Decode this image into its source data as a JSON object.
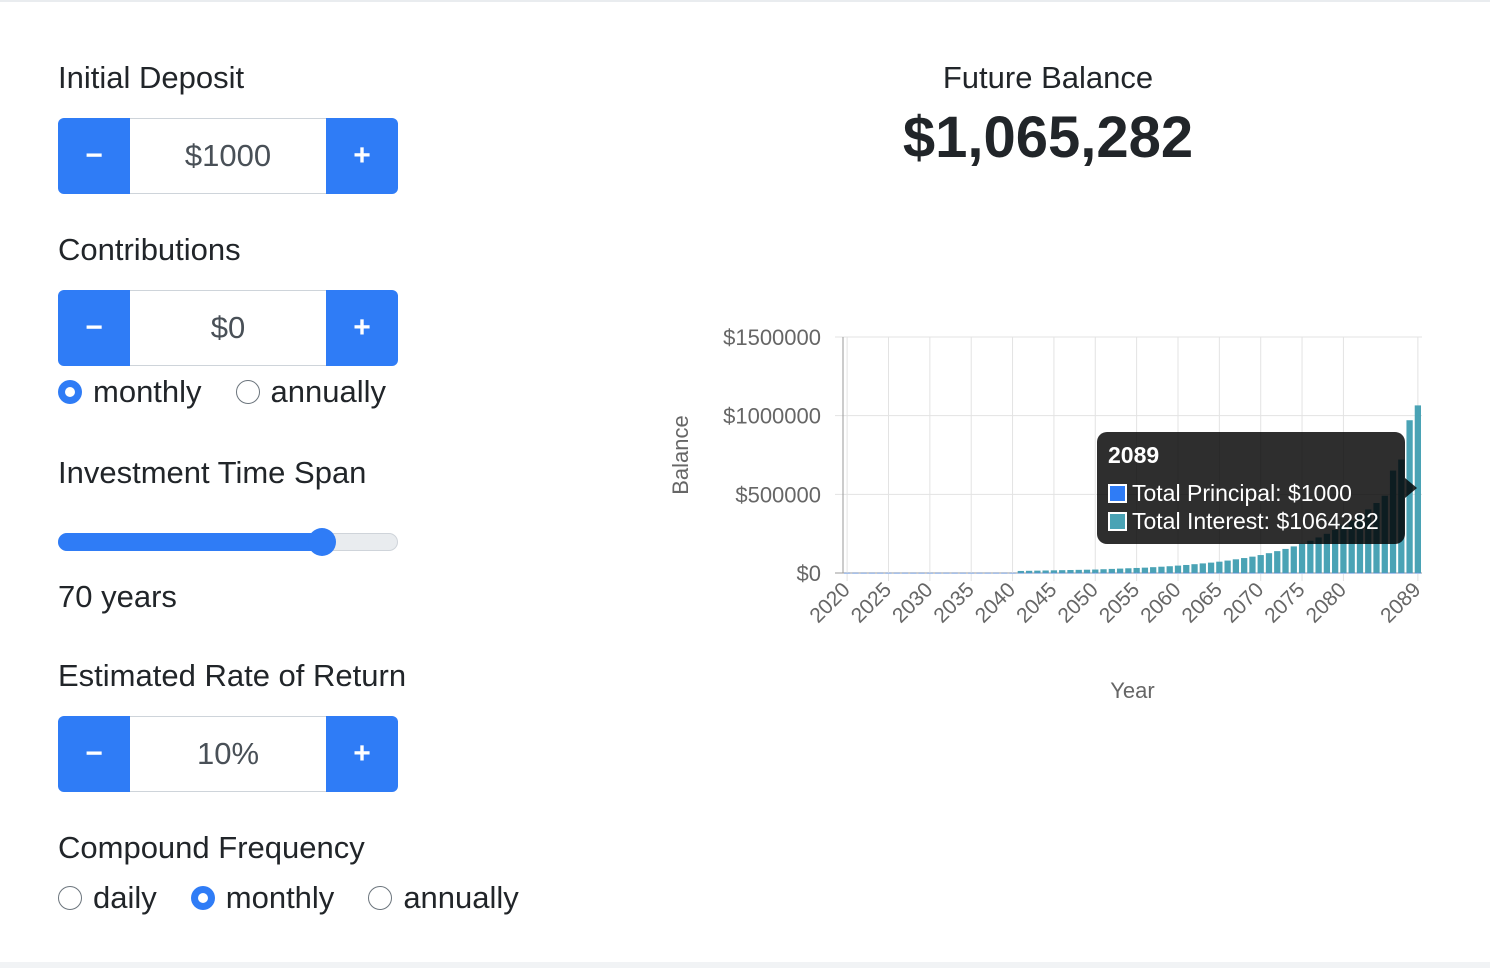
{
  "initial_deposit": {
    "label": "Initial Deposit",
    "minus": "−",
    "plus": "+",
    "value": "$1000"
  },
  "contributions": {
    "label": "Contributions",
    "minus": "−",
    "plus": "+",
    "value": "$0",
    "frequency_options": [
      {
        "label": "monthly",
        "selected": true
      },
      {
        "label": "annually",
        "selected": false
      }
    ]
  },
  "time_span": {
    "label": "Investment Time Span",
    "value_text": "70 years",
    "slider_fraction": 0.78
  },
  "rate_of_return": {
    "label": "Estimated Rate of Return",
    "minus": "−",
    "plus": "+",
    "value": "10%"
  },
  "compound_frequency": {
    "label": "Compound Frequency",
    "options": [
      {
        "label": "daily",
        "selected": false
      },
      {
        "label": "monthly",
        "selected": true
      },
      {
        "label": "annually",
        "selected": false
      }
    ]
  },
  "future_balance": {
    "title": "Future Balance",
    "value": "$1,065,282"
  },
  "colors": {
    "accent": "#2f7cf6",
    "interest_bar": "#4aa3b5",
    "principal": "#2f7cf6"
  },
  "chart_data": {
    "type": "bar",
    "ylabel": "Balance",
    "xlabel": "Year",
    "ylim": [
      0,
      1500000
    ],
    "y_ticks": [
      "$0",
      "$500000",
      "$1000000",
      "$1500000"
    ],
    "x_tick_labels": [
      "2020",
      "2025",
      "2030",
      "2035",
      "2040",
      "2045",
      "2050",
      "2055",
      "2060",
      "2065",
      "2070",
      "2075",
      "2080",
      "2089"
    ],
    "grid": true,
    "x": [
      2020,
      2021,
      2022,
      2023,
      2024,
      2025,
      2026,
      2027,
      2028,
      2029,
      2030,
      2031,
      2032,
      2033,
      2034,
      2035,
      2036,
      2037,
      2038,
      2039,
      2040,
      2041,
      2042,
      2043,
      2044,
      2045,
      2046,
      2047,
      2048,
      2049,
      2050,
      2051,
      2052,
      2053,
      2054,
      2055,
      2056,
      2057,
      2058,
      2059,
      2060,
      2061,
      2062,
      2063,
      2064,
      2065,
      2066,
      2067,
      2068,
      2069,
      2070,
      2071,
      2072,
      2073,
      2074,
      2075,
      2076,
      2077,
      2078,
      2079,
      2080,
      2081,
      2082,
      2083,
      2084,
      2085,
      2086,
      2087,
      2088,
      2089
    ],
    "series": [
      {
        "name": "Total Principal",
        "values": [
          1000,
          1000,
          1000,
          1000,
          1000,
          1000,
          1000,
          1000,
          1000,
          1000,
          1000,
          1000,
          1000,
          1000,
          1000,
          1000,
          1000,
          1000,
          1000,
          1000,
          1000,
          1000,
          1000,
          1000,
          1000,
          1000,
          1000,
          1000,
          1000,
          1000,
          1000,
          1000,
          1000,
          1000,
          1000,
          1000,
          1000,
          1000,
          1000,
          1000,
          1000,
          1000,
          1000,
          1000,
          1000,
          1000,
          1000,
          1000,
          1000,
          1000,
          1000,
          1000,
          1000,
          1000,
          1000,
          1000,
          1000,
          1000,
          1000,
          1000,
          1000,
          1000,
          1000,
          1000,
          1000,
          1000,
          1000,
          1000,
          1000,
          1000
        ]
      },
      {
        "name": "Total Interest",
        "values": [
          0,
          0,
          0,
          0,
          0,
          0,
          0,
          0,
          0,
          0,
          0,
          0,
          0,
          0,
          0,
          0,
          0,
          0,
          0,
          0,
          0,
          12000,
          13000,
          14000,
          15000,
          16000,
          17000,
          18000,
          19000,
          20000,
          21000,
          23000,
          25000,
          27000,
          29000,
          31000,
          33000,
          36000,
          39000,
          42000,
          46000,
          50000,
          55000,
          60000,
          65000,
          71000,
          78000,
          86000,
          94000,
          103000,
          113000,
          125000,
          138000,
          152000,
          168000,
          185000,
          204000,
          225000,
          248000,
          273000,
          301000,
          332000,
          366000,
          403000,
          444000,
          490000,
          650000,
          720000,
          970000,
          1064282
        ]
      }
    ],
    "tooltip": {
      "title": "2089",
      "rows": [
        "Total Principal: $1000",
        "Total Interest: $1064282"
      ]
    }
  }
}
